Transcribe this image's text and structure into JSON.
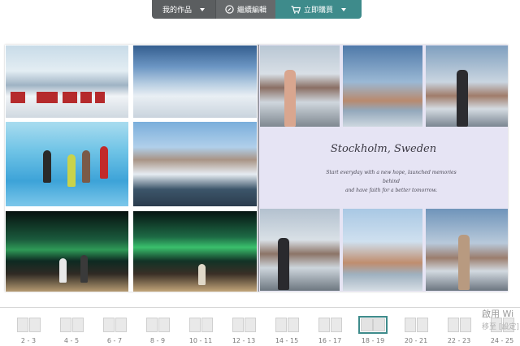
{
  "toolbar": {
    "my_works": "我的作品",
    "continue_edit": "繼續編輯",
    "buy_now": "立即購買",
    "edit_icon": "clock-pencil-icon",
    "cart_icon": "cart-icon"
  },
  "book": {
    "right_page": {
      "title": "Stockholm, Sweden",
      "body_line1": "Start everyday with a new hope, launched memories behind",
      "body_line2": "and have faith for a better tomorrow."
    }
  },
  "thumbnails": [
    {
      "label": "2 - 3",
      "active": false
    },
    {
      "label": "4 - 5",
      "active": false
    },
    {
      "label": "6 - 7",
      "active": false
    },
    {
      "label": "8 - 9",
      "active": false
    },
    {
      "label": "10 - 11",
      "active": false
    },
    {
      "label": "12 - 13",
      "active": false
    },
    {
      "label": "14 - 15",
      "active": false
    },
    {
      "label": "16 - 17",
      "active": false
    },
    {
      "label": "18 - 19",
      "active": true
    },
    {
      "label": "20 - 21",
      "active": false
    },
    {
      "label": "22 - 23",
      "active": false
    },
    {
      "label": "24 - 25",
      "active": false
    }
  ],
  "watermark": {
    "line1": "啟用 Wi",
    "line2": "移至 [設定]"
  },
  "colors": {
    "accent": "#3e8b8b",
    "toolbar_dark": "#5b5e60",
    "right_page_bg": "#e6e4f4"
  }
}
